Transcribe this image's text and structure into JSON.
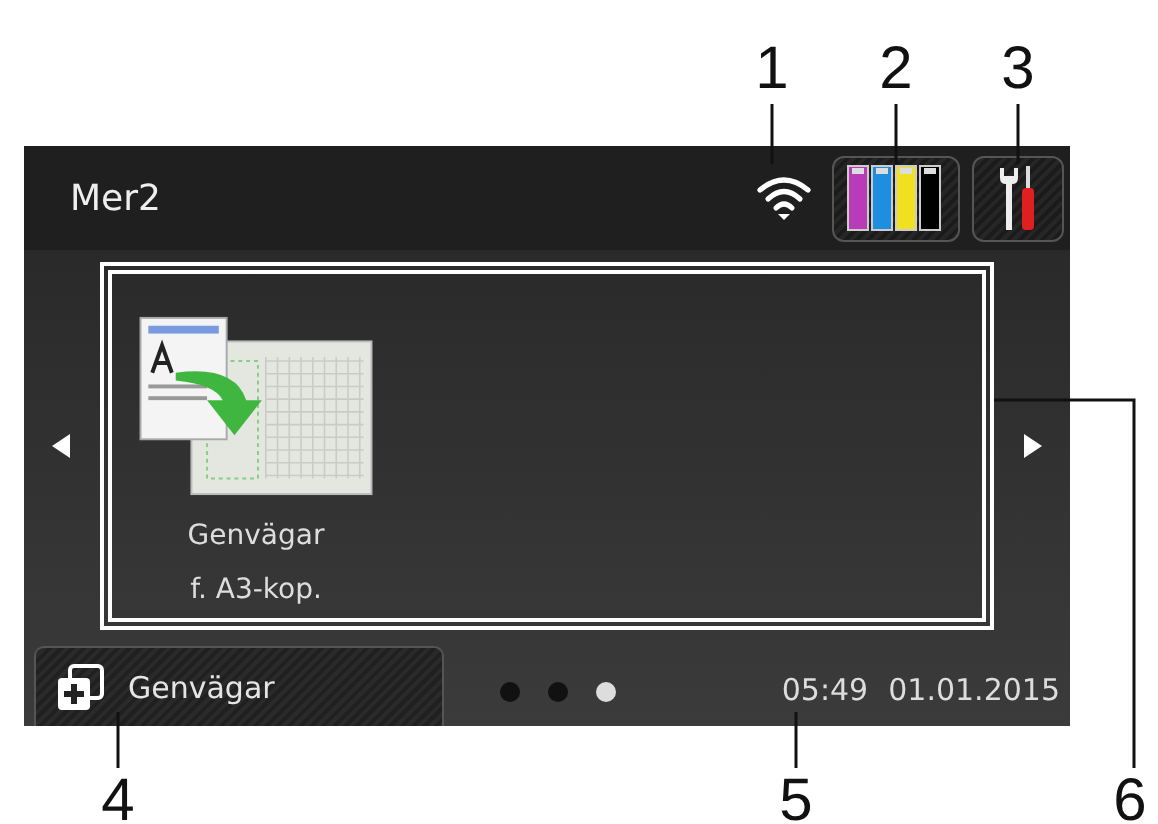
{
  "callouts_top": [
    {
      "number": "1"
    },
    {
      "number": "2"
    },
    {
      "number": "3"
    }
  ],
  "screen": {
    "title": "Mer2",
    "status_icons": [
      {
        "kind": "wifi"
      },
      {
        "kind": "ink"
      },
      {
        "kind": "settings"
      }
    ],
    "tiles": [
      {
        "label": "Genvägar\nf. A3-kop."
      }
    ],
    "shortcuts_button": {
      "label": "Genvägar"
    },
    "page_dots": [
      {
        "selected": false
      },
      {
        "selected": false
      },
      {
        "selected": true
      }
    ],
    "time": "05:49",
    "date": "01.01.2015"
  },
  "callouts_bottom": [
    {
      "number": "4"
    },
    {
      "number": "5"
    },
    {
      "number": "6"
    }
  ]
}
